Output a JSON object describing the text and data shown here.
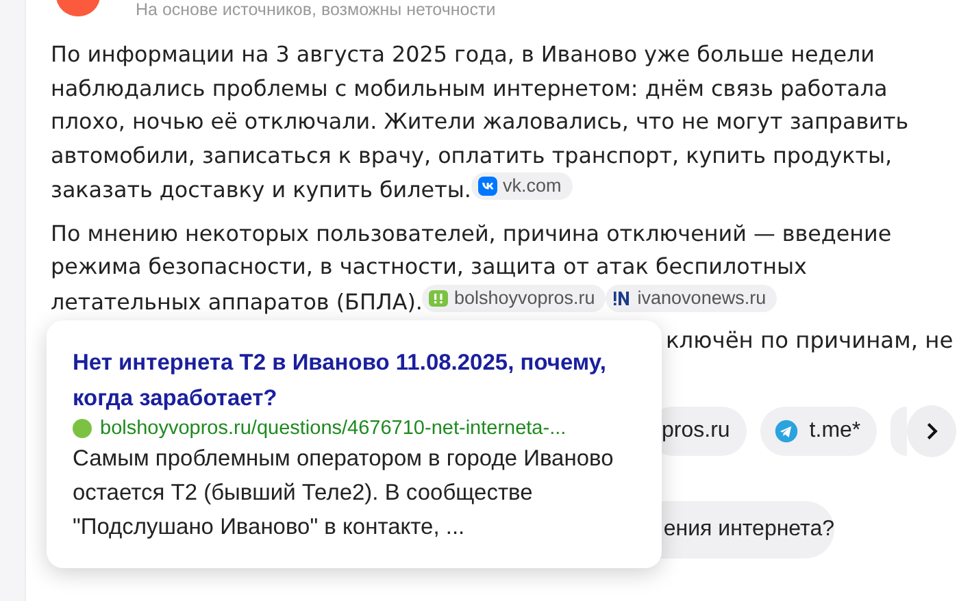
{
  "header": {
    "note": "На основе источников, возможны неточности"
  },
  "paragraphs": [
    {
      "text": "По информации на 3 августа 2025 года, в Иваново уже больше недели наблюдались проблемы с мобильным интернетом: днём связь работала плохо, ночью её отключали. Жители жаловались, что не могут заправить автомобили, записаться к врачу, оплатить транспорт, купить продукты, заказать доставку и купить билеты.",
      "sources": [
        {
          "kind": "vk",
          "label": "vk.com"
        }
      ]
    },
    {
      "text": "По мнению некоторых пользователей, причина отключений — введение режима безопасности, в частности, защита от атак беспилотных летательных аппаратов (БПЛА).",
      "sources": [
        {
          "kind": "bv",
          "label": "bolshoyvopros.ru"
        },
        {
          "kind": "in",
          "label": "ivanovonews.ru"
        }
      ]
    }
  ],
  "hidden_line": "ключён по причинам, не",
  "source_chips": [
    {
      "kind": "plain",
      "label": "pros.ru"
    },
    {
      "kind": "tg",
      "label": "t.me*"
    }
  ],
  "suggestion": {
    "text": "ения интернета?"
  },
  "popup": {
    "title": "Нет интернета Т2 в Иваново 11.08.2025, почему, когда заработает?",
    "url": "bolshoyvopros.ru/questions/4676710-net-interneta-...",
    "snippet": "Самым проблемным оператором в городе Иваново остается Т2 (бывший Теле2). В сообществе \"Подслушано Иваново\" в контакте, ..."
  }
}
